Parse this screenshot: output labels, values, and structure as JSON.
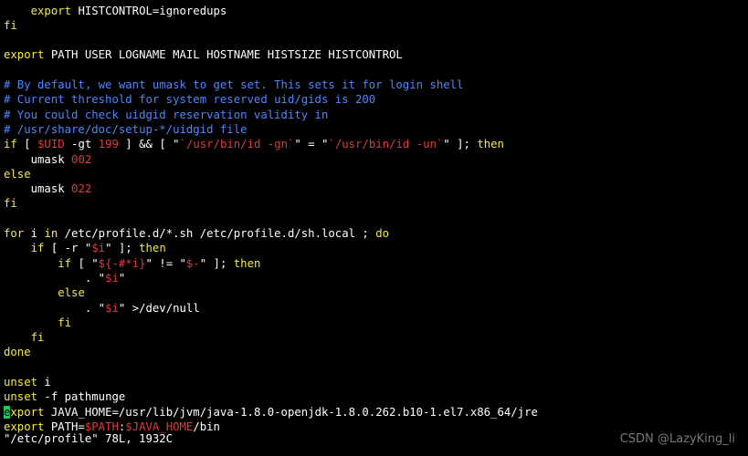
{
  "terminal": {
    "colors": {
      "background": "#000000",
      "text": "#ffffff",
      "keyword": "#f5e84a",
      "comment": "#4f87ff",
      "string_value": "#e03a3a",
      "cursor": "#22c55e"
    },
    "lines": [
      [
        {
          "t": "    ",
          "c": "w"
        },
        {
          "t": "export",
          "c": "y"
        },
        {
          "t": " HISTCONTROL=ignoredups",
          "c": "w"
        }
      ],
      [
        {
          "t": "fi",
          "c": "y"
        }
      ],
      [],
      [
        {
          "t": "export",
          "c": "y"
        },
        {
          "t": " PATH USER LOGNAME MAIL HOSTNAME HISTSIZE HISTCONTROL",
          "c": "w"
        }
      ],
      [],
      [
        {
          "t": "# By default, we want umask to get set. This sets it for login shell",
          "c": "c"
        }
      ],
      [
        {
          "t": "# Current threshold for system reserved uid/gids is 200",
          "c": "c"
        }
      ],
      [
        {
          "t": "# You could check uidgid reservation validity in",
          "c": "c"
        }
      ],
      [
        {
          "t": "# /usr/share/doc/setup-*/uidgid file",
          "c": "c"
        }
      ],
      [
        {
          "t": "if",
          "c": "y"
        },
        {
          "t": " [ ",
          "c": "w"
        },
        {
          "t": "$UID",
          "c": "r"
        },
        {
          "t": " -gt ",
          "c": "w"
        },
        {
          "t": "199",
          "c": "r"
        },
        {
          "t": " ] && [ \"",
          "c": "w"
        },
        {
          "t": "`/usr/bin/id -gn`",
          "c": "r"
        },
        {
          "t": "\" = \"",
          "c": "w"
        },
        {
          "t": "`/usr/bin/id -un`",
          "c": "r"
        },
        {
          "t": "\" ]; ",
          "c": "w"
        },
        {
          "t": "then",
          "c": "y"
        }
      ],
      [
        {
          "t": "    umask ",
          "c": "w"
        },
        {
          "t": "002",
          "c": "r"
        }
      ],
      [
        {
          "t": "else",
          "c": "y"
        }
      ],
      [
        {
          "t": "    umask ",
          "c": "w"
        },
        {
          "t": "022",
          "c": "r"
        }
      ],
      [
        {
          "t": "fi",
          "c": "y"
        }
      ],
      [],
      [
        {
          "t": "for",
          "c": "y"
        },
        {
          "t": " i ",
          "c": "w"
        },
        {
          "t": "in",
          "c": "y"
        },
        {
          "t": " /etc/profile.d/*.sh /etc/profile.d/sh.local ; ",
          "c": "w"
        },
        {
          "t": "do",
          "c": "y"
        }
      ],
      [
        {
          "t": "    ",
          "c": "w"
        },
        {
          "t": "if",
          "c": "y"
        },
        {
          "t": " [ -r \"",
          "c": "w"
        },
        {
          "t": "$i",
          "c": "r"
        },
        {
          "t": "\" ]; ",
          "c": "w"
        },
        {
          "t": "then",
          "c": "y"
        }
      ],
      [
        {
          "t": "        ",
          "c": "w"
        },
        {
          "t": "if",
          "c": "y"
        },
        {
          "t": " [ \"",
          "c": "w"
        },
        {
          "t": "${-#*i}",
          "c": "r"
        },
        {
          "t": "\" != \"",
          "c": "w"
        },
        {
          "t": "$-",
          "c": "r"
        },
        {
          "t": "\" ]; ",
          "c": "w"
        },
        {
          "t": "then",
          "c": "y"
        }
      ],
      [
        {
          "t": "            . \"",
          "c": "w"
        },
        {
          "t": "$i",
          "c": "r"
        },
        {
          "t": "\"",
          "c": "w"
        }
      ],
      [
        {
          "t": "        ",
          "c": "w"
        },
        {
          "t": "else",
          "c": "y"
        }
      ],
      [
        {
          "t": "            . \"",
          "c": "w"
        },
        {
          "t": "$i",
          "c": "r"
        },
        {
          "t": "\" >/dev/null",
          "c": "w"
        }
      ],
      [
        {
          "t": "        ",
          "c": "w"
        },
        {
          "t": "fi",
          "c": "y"
        }
      ],
      [
        {
          "t": "    ",
          "c": "w"
        },
        {
          "t": "fi",
          "c": "y"
        }
      ],
      [
        {
          "t": "done",
          "c": "y"
        }
      ],
      [],
      [
        {
          "t": "unset",
          "c": "y"
        },
        {
          "t": " i",
          "c": "w"
        }
      ],
      [
        {
          "t": "unset",
          "c": "y"
        },
        {
          "t": " -f pathmunge",
          "c": "w"
        }
      ],
      [
        {
          "t": "e",
          "c": "cur"
        },
        {
          "t": "xport",
          "c": "y"
        },
        {
          "t": " JAVA_HOME=/usr/lib/jvm/java-1.8.0-openjdk-1.8.0.262.b10-1.el7.x86_64/jre",
          "c": "w"
        }
      ],
      [
        {
          "t": "export",
          "c": "y"
        },
        {
          "t": " PATH=",
          "c": "w"
        },
        {
          "t": "$PATH",
          "c": "r"
        },
        {
          "t": ":",
          "c": "w"
        },
        {
          "t": "$JAVA_HOME",
          "c": "r"
        },
        {
          "t": "/bin",
          "c": "w"
        }
      ]
    ],
    "status_line": "\"/etc/profile\" 78L, 1932C",
    "watermark": "CSDN @LazyKing_li"
  }
}
